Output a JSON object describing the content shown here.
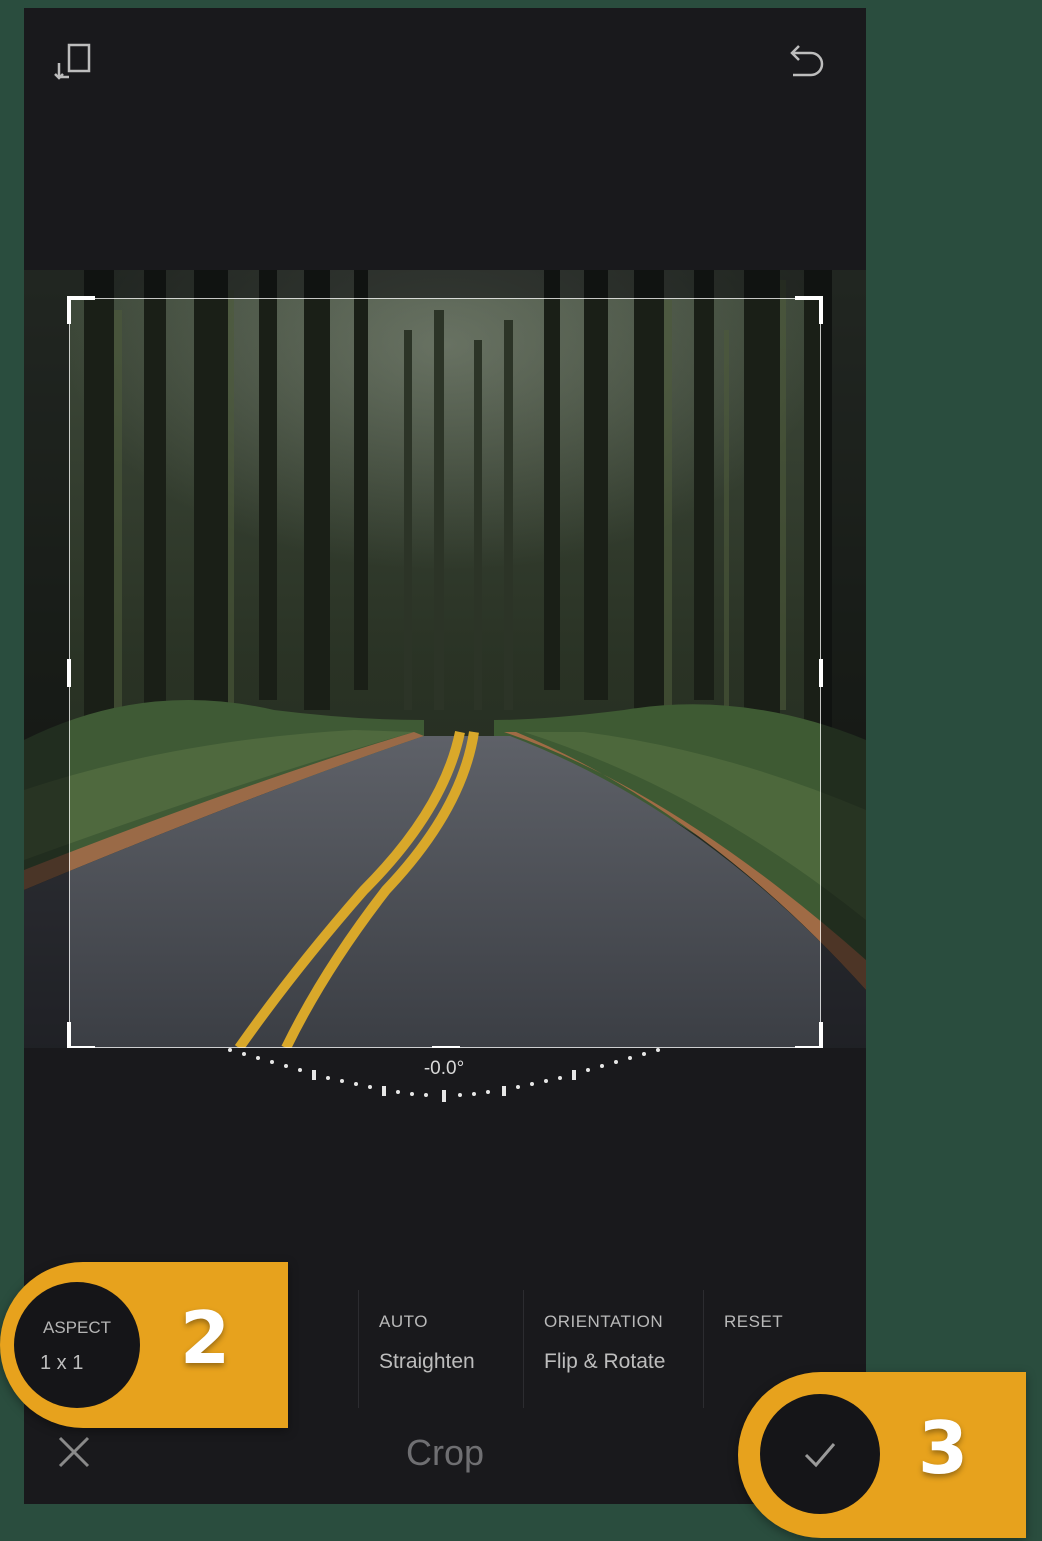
{
  "app": {
    "colors": {
      "background": "#2a4d3e",
      "panel": "#19191c",
      "accent": "#e7a21d"
    }
  },
  "top_bar": {
    "left_icon": "crop-rotate-icon",
    "right_icon": "undo-icon"
  },
  "image": {
    "subject": "forest road photo"
  },
  "dial": {
    "value": "-0.0°"
  },
  "toolbar": {
    "aspect": {
      "caption": "ASPECT",
      "value": "1 x 1"
    },
    "auto": {
      "caption": "AUTO",
      "value": "Straighten"
    },
    "orientation": {
      "caption": "ORIENTATION",
      "value": "Flip & Rotate"
    },
    "reset": {
      "caption": "RESET"
    }
  },
  "bottom_bar": {
    "title": "Crop",
    "close_icon": "close-icon",
    "confirm_icon": "checkmark-icon"
  },
  "callouts": {
    "step_2": "2",
    "step_3": "3"
  }
}
